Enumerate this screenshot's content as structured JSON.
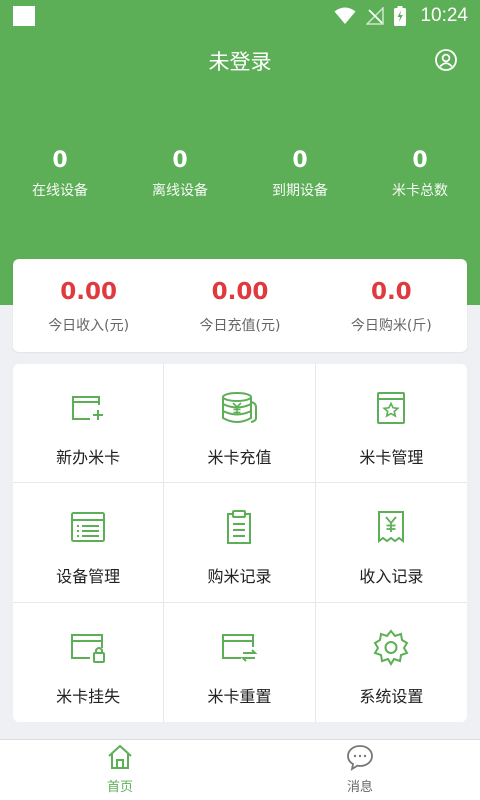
{
  "status_bar": {
    "time": "10:24"
  },
  "header": {
    "title": "未登录",
    "user_icon": "user-circle-icon"
  },
  "stats": [
    {
      "value": "0",
      "label": "在线设备"
    },
    {
      "value": "0",
      "label": "离线设备"
    },
    {
      "value": "0",
      "label": "到期设备"
    },
    {
      "value": "0",
      "label": "米卡总数"
    }
  ],
  "summary": [
    {
      "value": "0.00",
      "label": "今日收入(元)"
    },
    {
      "value": "0.00",
      "label": "今日充值(元)"
    },
    {
      "value": "0.0",
      "label": "今日购米(斤)"
    }
  ],
  "menu": [
    {
      "label": "新办米卡",
      "icon": "new-card-icon"
    },
    {
      "label": "米卡充值",
      "icon": "coins-icon"
    },
    {
      "label": "米卡管理",
      "icon": "card-manage-icon"
    },
    {
      "label": "设备管理",
      "icon": "device-list-icon"
    },
    {
      "label": "购米记录",
      "icon": "clipboard-icon"
    },
    {
      "label": "收入记录",
      "icon": "receipt-icon"
    },
    {
      "label": "米卡挂失",
      "icon": "card-lock-icon"
    },
    {
      "label": "米卡重置",
      "icon": "card-reset-icon"
    },
    {
      "label": "系统设置",
      "icon": "gear-icon"
    }
  ],
  "nav": [
    {
      "label": "首页",
      "icon": "home-icon",
      "active": true
    },
    {
      "label": "消息",
      "icon": "chat-icon",
      "active": false
    }
  ],
  "colors": {
    "primary": "#5daf57",
    "amount": "#e0393e",
    "background": "#eef0f3"
  }
}
